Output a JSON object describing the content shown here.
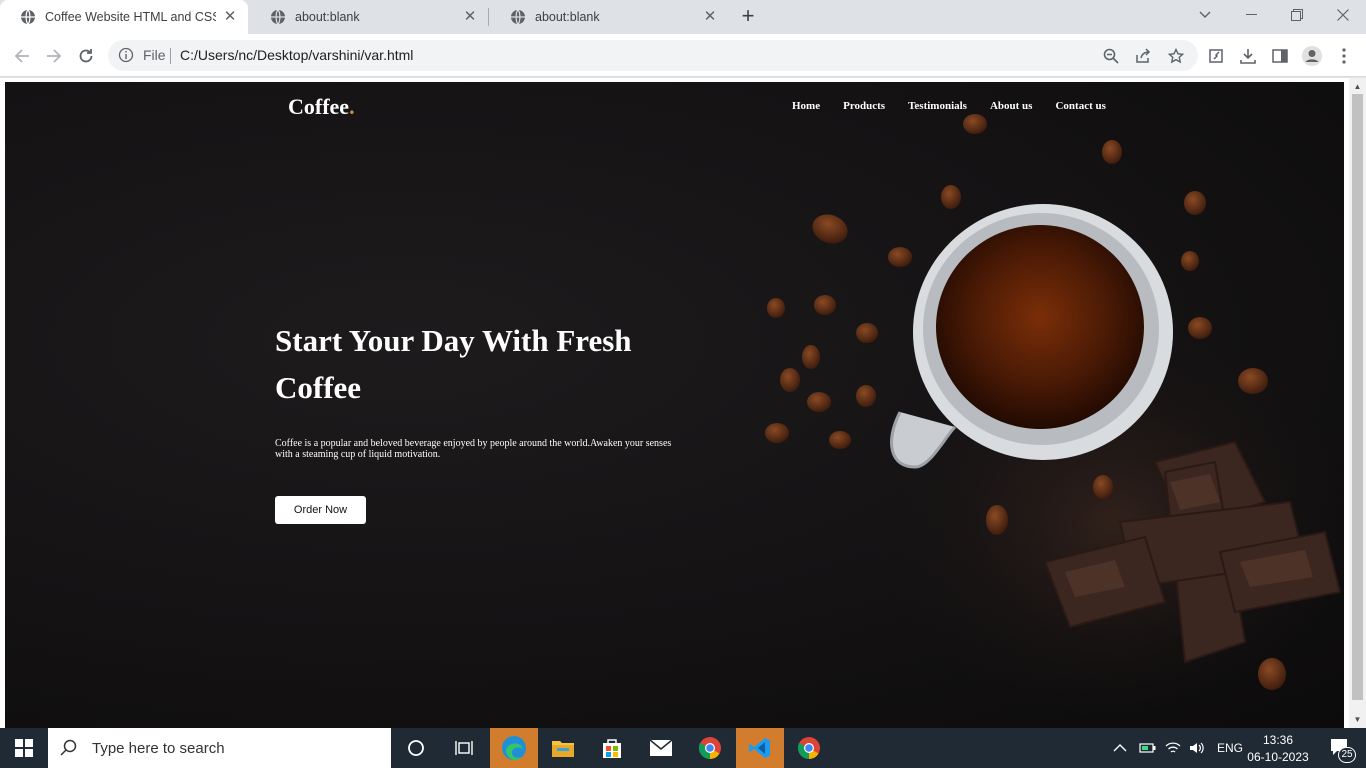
{
  "browser": {
    "tabs": [
      {
        "title": "Coffee Website HTML and CSS |",
        "active": true
      },
      {
        "title": "about:blank",
        "active": false
      },
      {
        "title": "about:blank",
        "active": false
      }
    ],
    "new_tab": "+",
    "address": {
      "scheme_label": "File",
      "url": "C:/Users/nc/Desktop/varshini/var.html"
    }
  },
  "site": {
    "logo": "Coffee",
    "logo_dot": ".",
    "nav": [
      "Home",
      "Products",
      "Testimonials",
      "About us",
      "Contact us"
    ],
    "headline": "Start Your Day With Fresh Coffee",
    "description": "Coffee is a popular and beloved beverage enjoyed by people around the world.Awaken your senses with a steaming cup of liquid motivation.",
    "cta": "Order Now"
  },
  "taskbar": {
    "search_placeholder": "Type here to search",
    "language": "ENG",
    "time": "13:36",
    "date": "06-10-2023",
    "notification_count": "25"
  },
  "colors": {
    "hero_bg": "#141213",
    "logo_accent": "#c98b46",
    "taskbar_bg": "#1f2a35",
    "taskbar_highlight": "#d27d2d"
  },
  "icons": [
    "globe-icon",
    "close-icon",
    "back-icon",
    "forward-icon",
    "reload-icon",
    "info-icon",
    "zoom-icon",
    "share-icon",
    "star-icon",
    "extension-icon",
    "download-icon",
    "sidepanel-icon",
    "profile-icon",
    "menu-icon",
    "windows-icon",
    "search-icon",
    "cortana-icon",
    "taskview-icon",
    "edge-icon",
    "explorer-icon",
    "store-icon",
    "mail-icon",
    "chrome-icon",
    "vscode-icon"
  ]
}
